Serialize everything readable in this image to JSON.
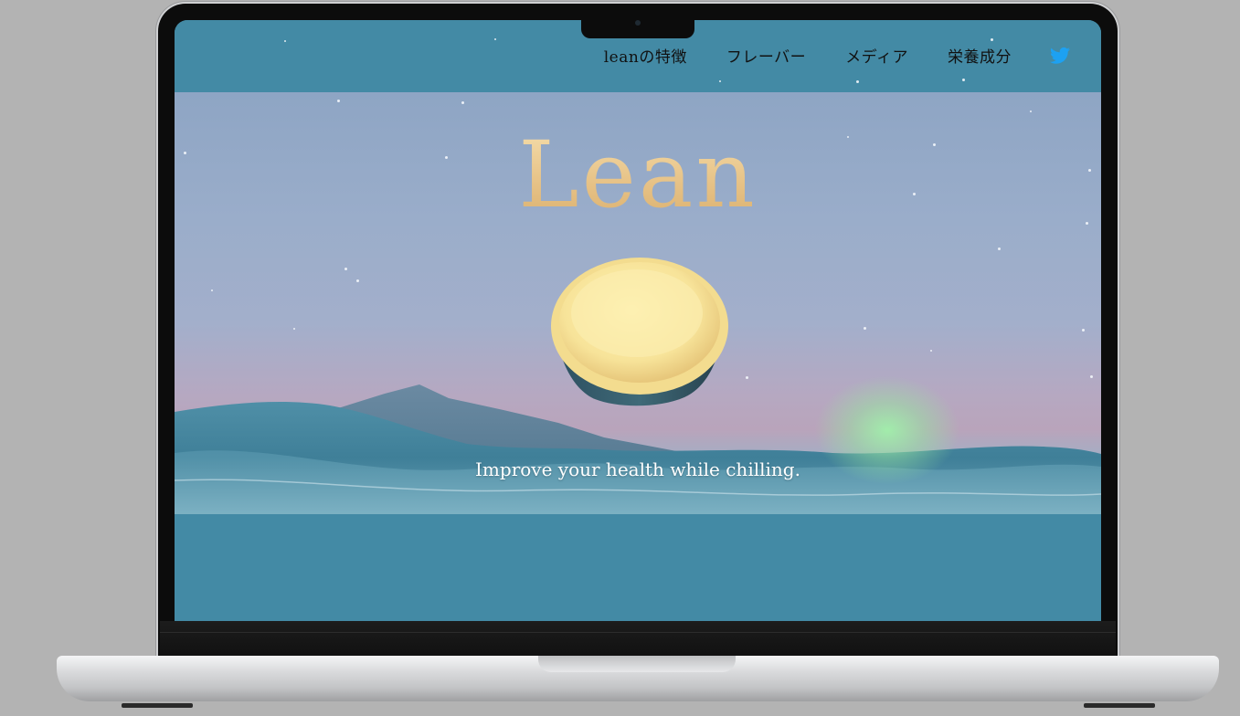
{
  "nav": {
    "links": [
      "leanの特徴",
      "フレーバー",
      "メディア",
      "栄養成分"
    ],
    "twitter_icon": "twitter-bird-icon"
  },
  "hero": {
    "title": "Lean",
    "tagline": "Improve your health while chilling."
  },
  "colors": {
    "screen_bg": "#438aa5",
    "title_gold": "#e8c98f",
    "twitter_blue": "#1da1f2"
  }
}
